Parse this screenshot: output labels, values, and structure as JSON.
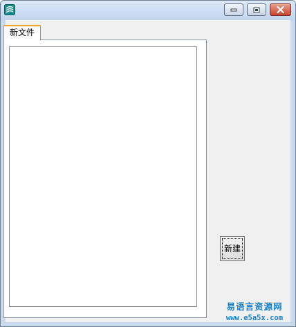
{
  "window": {
    "title": "",
    "icon": "easy-language-app-icon",
    "controls": {
      "minimize_icon": "minimize-icon",
      "maximize_icon": "maximize-icon",
      "close_icon": "close-icon"
    }
  },
  "tabs": [
    {
      "label": "新文件",
      "active": true
    }
  ],
  "editor": {
    "content": ""
  },
  "buttons": {
    "new_label": "新建"
  },
  "watermark": {
    "title": "易语言资源网",
    "url": "www.e5a5x.com"
  },
  "colors": {
    "titlebar": "#c9d9ee",
    "client_background": "#f0f0f0",
    "active_tab_accent": "#f5a623",
    "close_button": "#c7432d",
    "watermark": "#1a80c8"
  }
}
